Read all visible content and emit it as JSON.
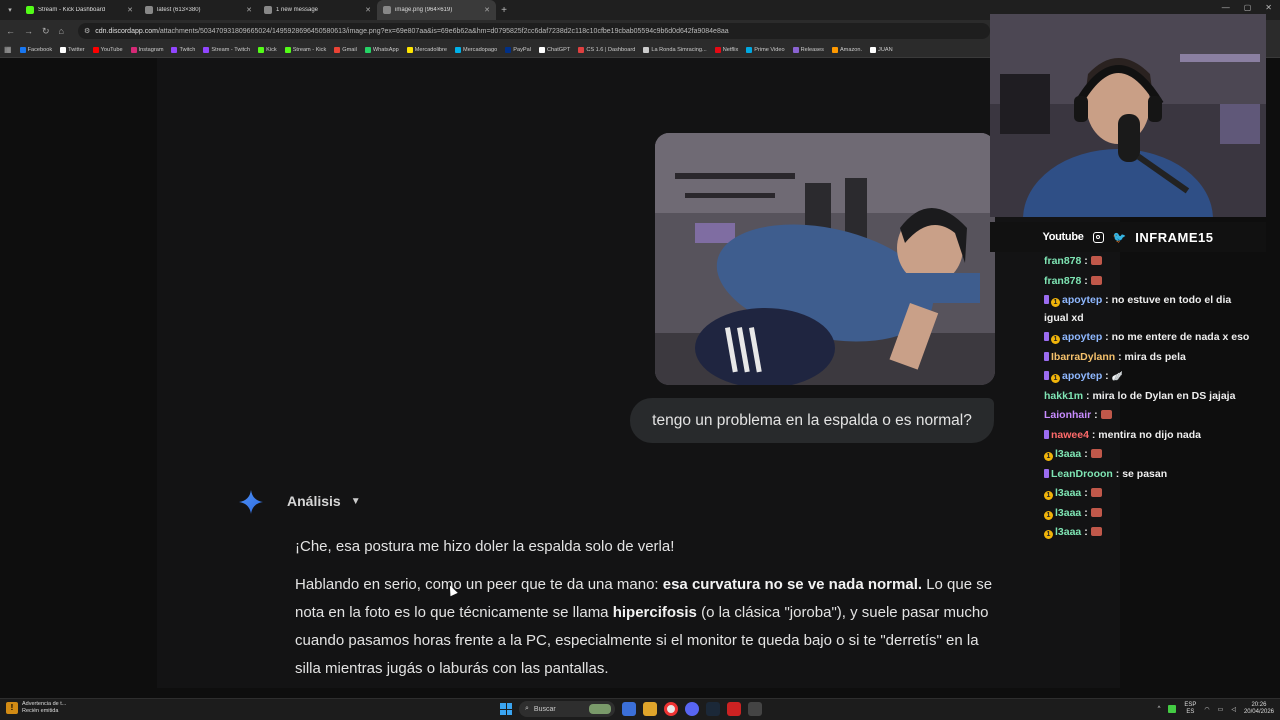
{
  "browser": {
    "tabs": [
      {
        "title": "Stream - Kick Dashboard",
        "color": "#53fc18",
        "active": false
      },
      {
        "title": "latest (613×380)",
        "color": "#888888",
        "active": false
      },
      {
        "title": "1 new message",
        "color": "#888888",
        "active": false
      },
      {
        "title": "image.png (964×619)",
        "color": "#888888",
        "active": true
      }
    ],
    "new_tab": "+",
    "url_host": "cdn.discordapp.com",
    "url_path": "/attachments/503470931809665024/1495928696450580613/image.png?ex=69e807aa&is=69e6b62a&hm=d0795825f2cc6daf7238d2c118c10cfbe19cbab05594c9b6d0d642fa9084e8aa",
    "bookmarks": [
      {
        "label": "Facebook",
        "color": "#1877f2"
      },
      {
        "label": "Twitter",
        "color": "#ffffff"
      },
      {
        "label": "YouTube",
        "color": "#ff0000"
      },
      {
        "label": "Instagram",
        "color": "#d62976"
      },
      {
        "label": "Twitch",
        "color": "#9146ff"
      },
      {
        "label": "Stream - Twitch",
        "color": "#9146ff"
      },
      {
        "label": "Kick",
        "color": "#53fc18"
      },
      {
        "label": "Stream - Kick",
        "color": "#53fc18"
      },
      {
        "label": "Gmail",
        "color": "#ea4335"
      },
      {
        "label": "WhatsApp",
        "color": "#25d366"
      },
      {
        "label": "Mercadolibre",
        "color": "#ffe600"
      },
      {
        "label": "Mercadopago",
        "color": "#00b1ea"
      },
      {
        "label": "PayPal",
        "color": "#003087"
      },
      {
        "label": "ChatGPT",
        "color": "#ffffff"
      },
      {
        "label": "CS 1.6 | Dashboard",
        "color": "#e04040"
      },
      {
        "label": "La Ronda Simracing...",
        "color": "#cccccc"
      },
      {
        "label": "Netflix",
        "color": "#e50914"
      },
      {
        "label": "Prime Video",
        "color": "#00a8e1"
      },
      {
        "label": "Releases",
        "color": "#8a63d2"
      },
      {
        "label": "Amazon.",
        "color": "#ff9900"
      },
      {
        "label": "JUAN",
        "color": "#ffffff"
      }
    ]
  },
  "conversation": {
    "user_message": "tengo un problema en la espalda o es normal?",
    "analysis_label": "Análisis",
    "para1": "¡Che, esa postura me hizo doler la espalda solo de verla!",
    "para2_a": "Hablando en serio, como un peer que te da una mano: ",
    "para2_b": "esa curvatura no se ve nada normal.",
    "para2_c": " Lo que se nota en la foto es lo que técnicamente se llama ",
    "para2_d": "hipercifosis",
    "para2_e": " (o la clásica \"joroba\"), y suele pasar mucho cuando pasamos horas frente a la PC, especialmente si el monitor te queda bajo o si te \"derretís\" en la silla mientras jugás o laburás con las pantallas."
  },
  "overlay": {
    "youtube": "Youtube",
    "handle": "INFRAME15"
  },
  "stream_chat": [
    {
      "user": "fran878",
      "color": "#7fe5b4",
      "badges": [],
      "text": "",
      "emote": true
    },
    {
      "user": "fran878",
      "color": "#7fe5b4",
      "badges": [],
      "text": "",
      "emote": true
    },
    {
      "user": "apoytep",
      "color": "#8fb8ff",
      "badges": [
        "mini",
        "sub"
      ],
      "text": "no estuve en todo el dia igual xd",
      "emote": false
    },
    {
      "user": "apoytep",
      "color": "#8fb8ff",
      "badges": [
        "mini",
        "sub"
      ],
      "text": "no me entere de nada x eso",
      "emote": false
    },
    {
      "user": "IbarraDylann",
      "color": "#f5c16c",
      "badges": [
        "mini"
      ],
      "text": "mira ds pela",
      "emote": false
    },
    {
      "user": "apoytep",
      "color": "#8fb8ff",
      "badges": [
        "mini",
        "sub"
      ],
      "text": "",
      "emote": false
    },
    {
      "user": "hakk1m",
      "color": "#7fe5b4",
      "badges": [],
      "text": "mira lo de Dylan en DS jajaja",
      "emote": false
    },
    {
      "user": "Laionhair",
      "color": "#c88cff",
      "badges": [],
      "text": "",
      "emote": true
    },
    {
      "user": "nawee4",
      "color": "#ff6b6b",
      "badges": [
        "mini"
      ],
      "text": "mentira no dijo nada",
      "emote": false
    },
    {
      "user": "l3aaa",
      "color": "#7fe5b4",
      "badges": [
        "sub"
      ],
      "text": "",
      "emote": true
    },
    {
      "user": "LeanDrooon",
      "color": "#7fe5b4",
      "badges": [
        "mini"
      ],
      "text": "se pasan",
      "emote": false
    },
    {
      "user": "l3aaa",
      "color": "#7fe5b4",
      "badges": [
        "sub"
      ],
      "text": "",
      "emote": true
    },
    {
      "user": "l3aaa",
      "color": "#7fe5b4",
      "badges": [
        "sub"
      ],
      "text": "",
      "emote": true
    },
    {
      "user": "l3aaa",
      "color": "#7fe5b4",
      "badges": [
        "sub"
      ],
      "text": "",
      "emote": true
    }
  ],
  "taskbar": {
    "notif_title": "Advertencia de t...",
    "notif_sub": "Recién emitida",
    "search_placeholder": "Buscar",
    "lang_top": "ESP",
    "lang_bottom": "ES",
    "time": "20:26",
    "date": "20/04/2026"
  },
  "colors": {
    "accent": "#4d8ff7",
    "bubble": "#282a2c",
    "chat_bg": "#131314"
  }
}
